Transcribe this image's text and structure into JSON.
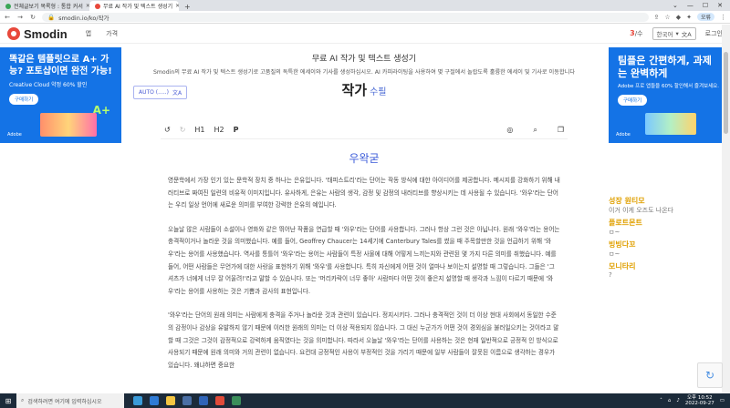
{
  "browser": {
    "tabs": [
      {
        "label": "전체글보기 목록형 : 통합 커서",
        "color": "#3aa757"
      },
      {
        "label": "무료 AI 작가 및 텍스트 생성기",
        "color": "#e8483b"
      }
    ],
    "new_tab": "+",
    "url": "smodin.io/ko/작가",
    "profile": "오류"
  },
  "site": {
    "logo": "Smodin",
    "nav": [
      "앱",
      "가격"
    ],
    "credits": "3",
    "credits_label": "/수",
    "language": "한국어",
    "login": "로그인"
  },
  "ad_left": {
    "headline": "똑같은 템플릿으로 A+ 가능? 포토샵이면 완전 가능!",
    "sub": "Creative Cloud 약정 60% 할인",
    "button": "구매하기",
    "grade": "A+",
    "brand": "Adobe"
  },
  "ad_right": {
    "headline": "팀플은 간편하게, 과제는 완벽하게",
    "sub": "Adobe 프로 앱들을 60% 할인해서 즐겨보세요.",
    "button": "구매하기",
    "brand": "Adobe"
  },
  "main": {
    "headline": "무료 AI 작가 및 텍스트 생성기",
    "subhead": "Smodin의 무료 AI 작가 및 텍스트 생성기로 고품질의 독특한 에세이와 기사를 생성하십시오. AI 카피라이팅을 사용하여 몇 구절에서 놀랍도록 훌륭한 에세이 및 기사로 이동합니다",
    "auto_select": "AUTO (.....)",
    "title": "작가",
    "title_mod": "수필"
  },
  "editor": {
    "toolbar": {
      "h1": "H1",
      "h2": "H2",
      "p": "P"
    },
    "doc_title": "우왁굳",
    "paragraphs": [
      "영문학에서 가장 인기 있는 문학적 장치 중 하나는 은유입니다. '태피스트리'라는 단어는 작동 방식에 대한 아이디어를 제공합니다. 메시지를 강화하기 위해 내러티브로 짜여진 일련의 비유적 이미지입니다. 유사하게, 은유는 사람의 생각, 감정 및 감정의 내러티브를 향상시키는 데 사용될 수 있습니다. '와우'라는 단어는 우리 일상 언어에 새로운 의미를 부여한 강력한 은유의 예입니다.",
      "오늘날 많은 사람들이 소설이나 영화와 같은 뛰어난 작품을 연급할 때 '와우'라는 단어를 사용합니다. 그러나 항상 그런 것은 아닙니다. 원래 '와우'라는 용어는 충격적이거나 놀라운 것을 의미했습니다. 예를 들어, Geoffrey Chaucer는 14세기에 Canterbury Tales를 썼을 때 주목할만한 것을 언급하기 위해 '와우'라는 용어를 사용했습니다. 역사를 통틀어 '와우'라는 용어는 사람들이 특정 사물에 대해 어떻게 느끼는지와 관련된 몇 가지 다른 의미를 취했습니다. 예를 들어, 어떤 사람들은 무언가에 대한 사랑을 표현하기 위해 '와우'를 사용합니다. 특히 자신에게 어떤 것이 얼마나 보이는지 설명할 때 그렇습니다. 그들은 '그 셔츠가 너에게 너무 잘 어울려!'라고 말할 수 있습니다. 또는 '머리카락이 너무 좋아' 사람마다 어떤 것이 좋은지 설명할 때 생각과 느낌이 다르기 때문에 '와우'라는 용어를 사용하는 것은 기쁨과 감사의 표현입니다.",
      "'와우'라는 단어의 원래 의미는 사람에게 충격을 주거나 놀라운 것과 관련이 있습니다. 정지시키다. 그러나 충격적인 것이 더 이상 현대 사회에서 동일한 수준의 감정이나 감상을 유발하지 않기 때문에 이러한 원래의 의미는 더 이상 적용되지 않습니다. 그 대신 누군가가 어떤 것이 경외심을 불러일으키는 것이라고 말할 때 그것은 그것이 감정적으로 강력하게 움직였다는 것을 의미합니다. 따라서 오늘날 '와우'라는 단어를 사용하는 것은 현재 일반적으로 긍정적 인 방식으로 사용되기 때문에 원래 의미와 거의 관련이 없습니다. 요컨대 긍정적인 사용이 부정적인 것을 가리기 때문에 일부 사람들이 잘못된 이름으로 생각하는 경우가 있습니다. 왜냐하면 중요한"
    ]
  },
  "sidebar_list": [
    {
      "title": "성장 원티모",
      "desc": "이거 이게 오즈도 나온다"
    },
    {
      "title": "플로트몬트",
      "desc": "ㅁ~"
    },
    {
      "title": "빙빙다꼬",
      "desc": "ㅁ~"
    },
    {
      "title": "모니타리",
      "desc": "?"
    }
  ],
  "taskbar": {
    "search_placeholder": "검색하려면 여기에 입력하십시오",
    "time": "오후 10:52",
    "date": "2022-09-27"
  },
  "colors": {
    "brand": "#e8483b",
    "accent": "#3b5bd9",
    "ad_blue": "#1473e6",
    "highlight": "#e0a000"
  }
}
